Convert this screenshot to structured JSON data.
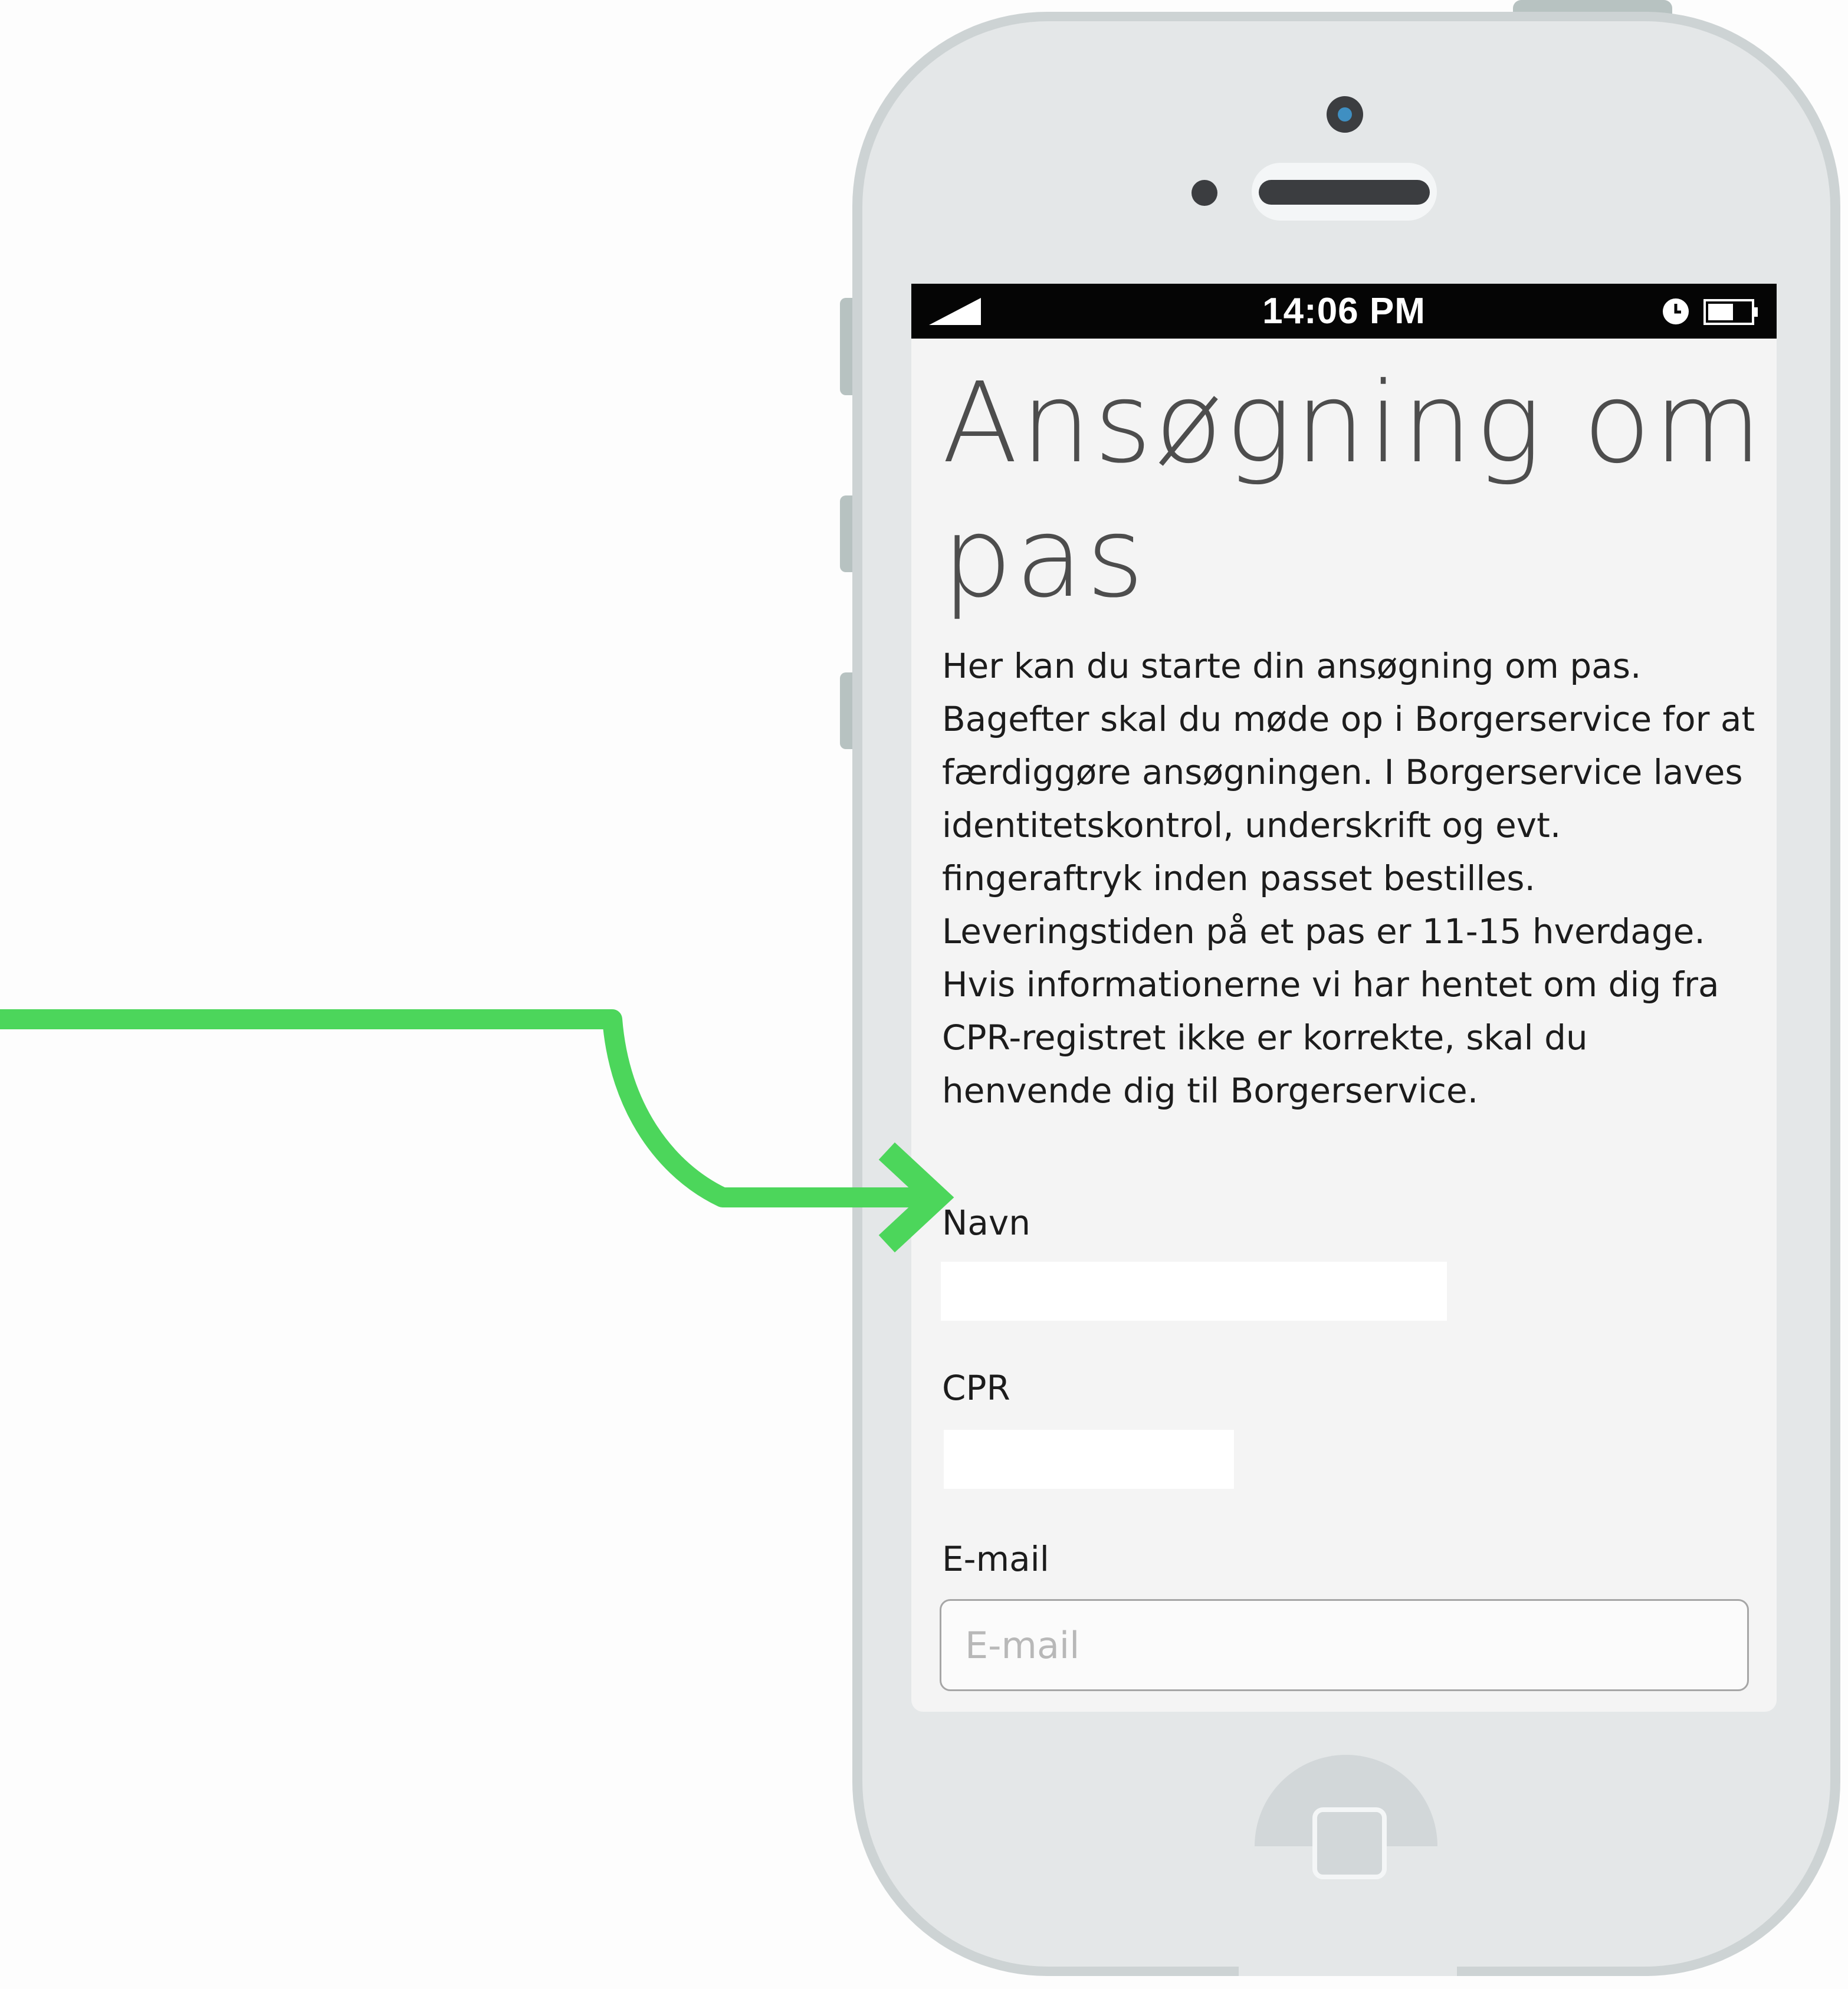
{
  "status_bar": {
    "time": "14:06 PM",
    "signal_icon": "signal-icon",
    "alarm_icon": "alarm-clock-icon",
    "battery_icon": "battery-icon"
  },
  "page": {
    "title": "Ansøgning om pas",
    "intro": "Her kan du starte din ansøgning om pas. Bagefter skal du møde op i Borgerservice for at færdiggøre ansøgningen. I Borgerservice laves identitetskontrol, underskrift og evt. fingeraftryk inden passet bestilles. Leveringstiden på et pas er 11-15 hverdage. Hvis informationerne vi har hentet om dig fra CPR-registret ikke er korrekte, skal du henvende dig til Borgerservice."
  },
  "form": {
    "name": {
      "label": "Navn",
      "value": ""
    },
    "cpr": {
      "label": "CPR",
      "value": ""
    },
    "email": {
      "label": "E-mail",
      "value": "",
      "placeholder": "E-mail"
    }
  },
  "annotation": {
    "color": "#4cd65b",
    "icon": "pointer-arrow-icon"
  }
}
